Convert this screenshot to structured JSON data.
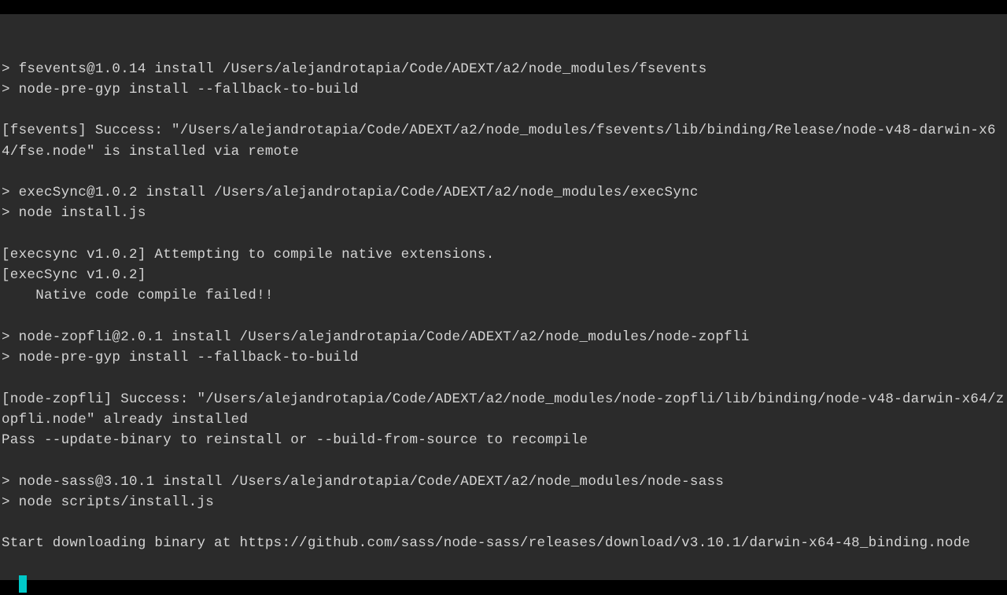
{
  "terminal": {
    "lines": [
      "> fsevents@1.0.14 install /Users/alejandrotapia/Code/ADEXT/a2/node_modules/fsevents",
      "> node-pre-gyp install --fallback-to-build",
      "",
      "[fsevents] Success: \"/Users/alejandrotapia/Code/ADEXT/a2/node_modules/fsevents/lib/binding/Release/node-v48-darwin-x64/fse.node\" is installed via remote",
      "",
      "> execSync@1.0.2 install /Users/alejandrotapia/Code/ADEXT/a2/node_modules/execSync",
      "> node install.js",
      "",
      "[execsync v1.0.2] Attempting to compile native extensions.",
      "[execSync v1.0.2]",
      "    Native code compile failed!!",
      "",
      "> node-zopfli@2.0.1 install /Users/alejandrotapia/Code/ADEXT/a2/node_modules/node-zopfli",
      "> node-pre-gyp install --fallback-to-build",
      "",
      "[node-zopfli] Success: \"/Users/alejandrotapia/Code/ADEXT/a2/node_modules/node-zopfli/lib/binding/node-v48-darwin-x64/zopfli.node\" already installed",
      "Pass --update-binary to reinstall or --build-from-source to recompile",
      "",
      "> node-sass@3.10.1 install /Users/alejandrotapia/Code/ADEXT/a2/node_modules/node-sass",
      "> node scripts/install.js",
      "",
      "Start downloading binary at https://github.com/sass/node-sass/releases/download/v3.10.1/darwin-x64-48_binding.node"
    ]
  }
}
